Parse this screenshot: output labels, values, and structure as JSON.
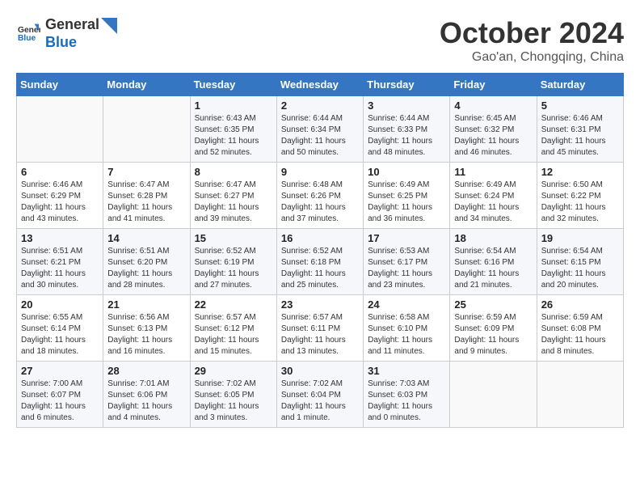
{
  "header": {
    "logo_line1": "General",
    "logo_line2": "Blue",
    "month": "October 2024",
    "location": "Gao'an, Chongqing, China"
  },
  "days_of_week": [
    "Sunday",
    "Monday",
    "Tuesday",
    "Wednesday",
    "Thursday",
    "Friday",
    "Saturday"
  ],
  "weeks": [
    [
      {
        "day": "",
        "content": ""
      },
      {
        "day": "",
        "content": ""
      },
      {
        "day": "1",
        "content": "Sunrise: 6:43 AM\nSunset: 6:35 PM\nDaylight: 11 hours and 52 minutes."
      },
      {
        "day": "2",
        "content": "Sunrise: 6:44 AM\nSunset: 6:34 PM\nDaylight: 11 hours and 50 minutes."
      },
      {
        "day": "3",
        "content": "Sunrise: 6:44 AM\nSunset: 6:33 PM\nDaylight: 11 hours and 48 minutes."
      },
      {
        "day": "4",
        "content": "Sunrise: 6:45 AM\nSunset: 6:32 PM\nDaylight: 11 hours and 46 minutes."
      },
      {
        "day": "5",
        "content": "Sunrise: 6:46 AM\nSunset: 6:31 PM\nDaylight: 11 hours and 45 minutes."
      }
    ],
    [
      {
        "day": "6",
        "content": "Sunrise: 6:46 AM\nSunset: 6:29 PM\nDaylight: 11 hours and 43 minutes."
      },
      {
        "day": "7",
        "content": "Sunrise: 6:47 AM\nSunset: 6:28 PM\nDaylight: 11 hours and 41 minutes."
      },
      {
        "day": "8",
        "content": "Sunrise: 6:47 AM\nSunset: 6:27 PM\nDaylight: 11 hours and 39 minutes."
      },
      {
        "day": "9",
        "content": "Sunrise: 6:48 AM\nSunset: 6:26 PM\nDaylight: 11 hours and 37 minutes."
      },
      {
        "day": "10",
        "content": "Sunrise: 6:49 AM\nSunset: 6:25 PM\nDaylight: 11 hours and 36 minutes."
      },
      {
        "day": "11",
        "content": "Sunrise: 6:49 AM\nSunset: 6:24 PM\nDaylight: 11 hours and 34 minutes."
      },
      {
        "day": "12",
        "content": "Sunrise: 6:50 AM\nSunset: 6:22 PM\nDaylight: 11 hours and 32 minutes."
      }
    ],
    [
      {
        "day": "13",
        "content": "Sunrise: 6:51 AM\nSunset: 6:21 PM\nDaylight: 11 hours and 30 minutes."
      },
      {
        "day": "14",
        "content": "Sunrise: 6:51 AM\nSunset: 6:20 PM\nDaylight: 11 hours and 28 minutes."
      },
      {
        "day": "15",
        "content": "Sunrise: 6:52 AM\nSunset: 6:19 PM\nDaylight: 11 hours and 27 minutes."
      },
      {
        "day": "16",
        "content": "Sunrise: 6:52 AM\nSunset: 6:18 PM\nDaylight: 11 hours and 25 minutes."
      },
      {
        "day": "17",
        "content": "Sunrise: 6:53 AM\nSunset: 6:17 PM\nDaylight: 11 hours and 23 minutes."
      },
      {
        "day": "18",
        "content": "Sunrise: 6:54 AM\nSunset: 6:16 PM\nDaylight: 11 hours and 21 minutes."
      },
      {
        "day": "19",
        "content": "Sunrise: 6:54 AM\nSunset: 6:15 PM\nDaylight: 11 hours and 20 minutes."
      }
    ],
    [
      {
        "day": "20",
        "content": "Sunrise: 6:55 AM\nSunset: 6:14 PM\nDaylight: 11 hours and 18 minutes."
      },
      {
        "day": "21",
        "content": "Sunrise: 6:56 AM\nSunset: 6:13 PM\nDaylight: 11 hours and 16 minutes."
      },
      {
        "day": "22",
        "content": "Sunrise: 6:57 AM\nSunset: 6:12 PM\nDaylight: 11 hours and 15 minutes."
      },
      {
        "day": "23",
        "content": "Sunrise: 6:57 AM\nSunset: 6:11 PM\nDaylight: 11 hours and 13 minutes."
      },
      {
        "day": "24",
        "content": "Sunrise: 6:58 AM\nSunset: 6:10 PM\nDaylight: 11 hours and 11 minutes."
      },
      {
        "day": "25",
        "content": "Sunrise: 6:59 AM\nSunset: 6:09 PM\nDaylight: 11 hours and 9 minutes."
      },
      {
        "day": "26",
        "content": "Sunrise: 6:59 AM\nSunset: 6:08 PM\nDaylight: 11 hours and 8 minutes."
      }
    ],
    [
      {
        "day": "27",
        "content": "Sunrise: 7:00 AM\nSunset: 6:07 PM\nDaylight: 11 hours and 6 minutes."
      },
      {
        "day": "28",
        "content": "Sunrise: 7:01 AM\nSunset: 6:06 PM\nDaylight: 11 hours and 4 minutes."
      },
      {
        "day": "29",
        "content": "Sunrise: 7:02 AM\nSunset: 6:05 PM\nDaylight: 11 hours and 3 minutes."
      },
      {
        "day": "30",
        "content": "Sunrise: 7:02 AM\nSunset: 6:04 PM\nDaylight: 11 hours and 1 minute."
      },
      {
        "day": "31",
        "content": "Sunrise: 7:03 AM\nSunset: 6:03 PM\nDaylight: 11 hours and 0 minutes."
      },
      {
        "day": "",
        "content": ""
      },
      {
        "day": "",
        "content": ""
      }
    ]
  ]
}
